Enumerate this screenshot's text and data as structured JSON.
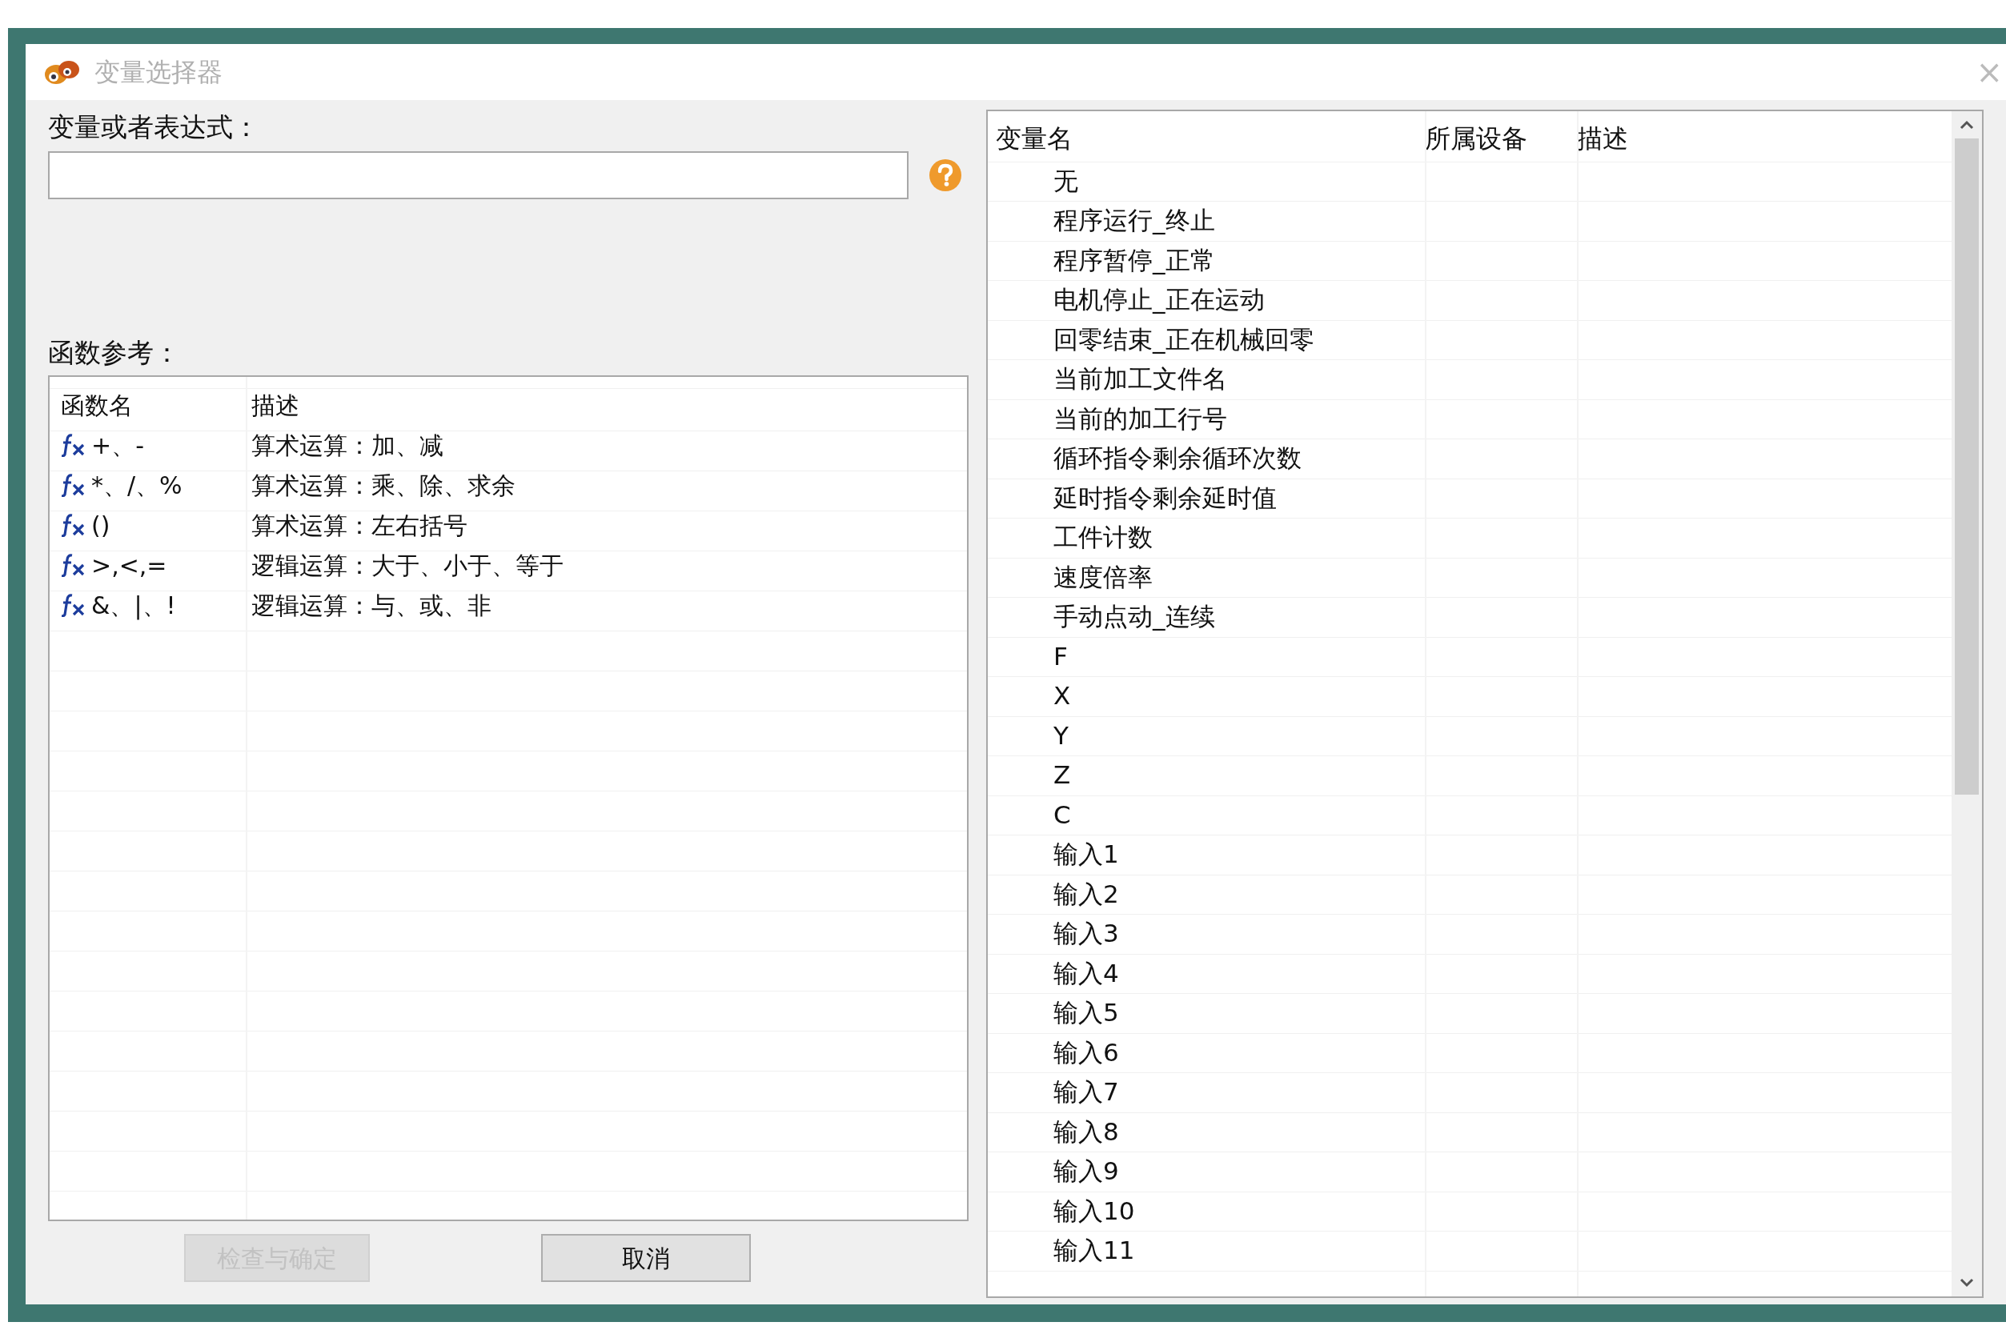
{
  "window": {
    "title": "变量选择器",
    "active": false,
    "close": "×"
  },
  "expression": {
    "label": "变量或者表达式："
  },
  "function_reference": {
    "label": "函数参考：",
    "columns": [
      "函数名",
      "描述"
    ],
    "rows": [
      {
        "name": "+、-",
        "description": "算术运算：加、减"
      },
      {
        "name": "*、/、%",
        "description": "算术运算：乘、除、求余"
      },
      {
        "name": "()",
        "description": "算术运算：左右括号"
      },
      {
        "name": ">,<,=",
        "description": "逻辑运算：大于、小于、等于"
      },
      {
        "name": "&、|、!",
        "description": "逻辑运算：与、或、非"
      }
    ]
  },
  "buttons": [
    {
      "label": "检查与确定",
      "disabled": true
    },
    {
      "label": "取消",
      "disabled": false
    }
  ],
  "variables": {
    "columns": [
      "变量名",
      "所属设备",
      "描述"
    ],
    "rows": [
      {
        "name": "无"
      },
      {
        "name": "程序运行_终止"
      },
      {
        "name": "程序暂停_正常"
      },
      {
        "name": "电机停止_正在运动"
      },
      {
        "name": "回零结束_正在机械回零"
      },
      {
        "name": "当前加工文件名"
      },
      {
        "name": "当前的加工行号"
      },
      {
        "name": "循环指令剩余循环次数"
      },
      {
        "name": "延时指令剩余延时值"
      },
      {
        "name": "工件计数"
      },
      {
        "name": "速度倍率"
      },
      {
        "name": "手动点动_连续"
      },
      {
        "name": "F"
      },
      {
        "name": "X"
      },
      {
        "name": "Y"
      },
      {
        "name": "Z"
      },
      {
        "name": "C"
      },
      {
        "name": "输入1"
      },
      {
        "name": "输入2"
      },
      {
        "name": "输入3"
      },
      {
        "name": "输入4"
      },
      {
        "name": "输入5"
      },
      {
        "name": "输入6"
      },
      {
        "name": "输入7"
      },
      {
        "name": "输入8"
      },
      {
        "name": "输入9"
      },
      {
        "name": "输入10"
      },
      {
        "name": "输入11"
      }
    ]
  }
}
